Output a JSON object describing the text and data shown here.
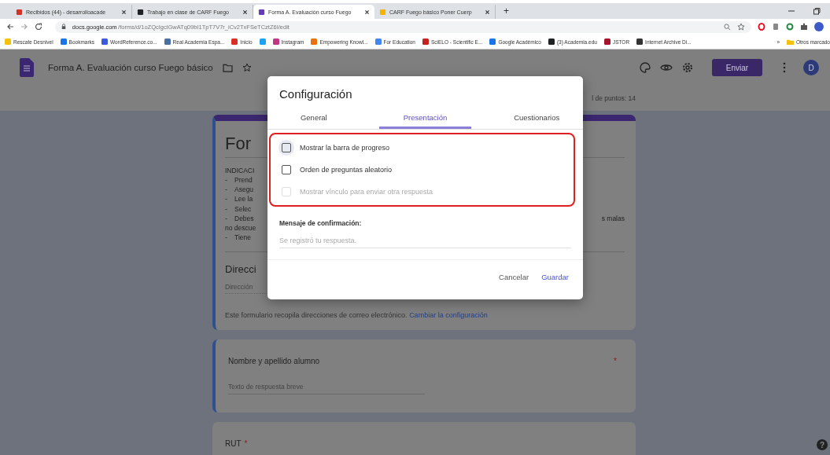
{
  "browser": {
    "tabs": [
      {
        "title": "Recibidos (44) - desarrolloacade",
        "selected": false,
        "color": "#d93025"
      },
      {
        "title": "Trabajo en clase de CARF Fuego",
        "selected": false,
        "color": "#202124"
      },
      {
        "title": "Forma A. Evaluación curso Fuego",
        "selected": true,
        "color": "#673ab7"
      },
      {
        "title": "CARF Fuego básico Poner Cuerp",
        "selected": false,
        "color": "#f4b400"
      }
    ],
    "new_tab": "+",
    "address": {
      "domain": "docs.google.com",
      "path": "/forms/d/1oZQcIgclGwATq09bI1TpT7V7r_iCv2TxFSeTCztZ6I/edit"
    },
    "bookmarks": [
      {
        "label": "Rescate Desnivel",
        "color": "#f4c20d"
      },
      {
        "label": "Bookmarks",
        "color": "#1a73e8"
      },
      {
        "label": "WordReference.co...",
        "color": "#3b5bdb"
      },
      {
        "label": "Real Academia Espa...",
        "color": "#4a6fa5"
      },
      {
        "label": "Inicio",
        "color": "#d93025"
      },
      {
        "color": "#1da1f2"
      },
      {
        "label": "Instagram",
        "color": "#c13584"
      },
      {
        "label": "Empowering Knowl...",
        "color": "#e8710a"
      },
      {
        "label": "For Education",
        "color": "#4285f4"
      },
      {
        "label": "SciELO - Scientific E...",
        "color": "#c5221f"
      },
      {
        "label": "Google Académico",
        "color": "#1a73e8"
      },
      {
        "label": "(3) Academia.edu",
        "color": "#202124"
      },
      {
        "label": "JSTOR",
        "color": "#a5142b"
      },
      {
        "label": "Internet Archive Di...",
        "color": "#333333"
      }
    ],
    "bookmarks_more": "»",
    "other_bookmarks": "Otros marcado"
  },
  "form_header": {
    "title": "Forma A. Evaluación curso Fuego básico",
    "send_button": "Enviar",
    "avatar": "D"
  },
  "points_text": "l de puntos: 14",
  "form_card": {
    "title": "For",
    "heading": "INDICACI",
    "lines": [
      {
        "bullet": "-",
        "text": "Prend"
      },
      {
        "bullet": "-",
        "text": "Asegu"
      },
      {
        "bullet": "-",
        "text": "Lee la"
      },
      {
        "bullet": "-",
        "text": "Selec"
      },
      {
        "bullet": "-",
        "text": "Debes",
        "tail": "s malas"
      },
      {
        "text": "no descue"
      },
      {
        "bullet": "-",
        "text": "Tiene"
      }
    ],
    "email_title": "Direcci",
    "email_placeholder": "Dirección",
    "note": {
      "text": "Este formulario recopila direcciones de correo electrónico.",
      "link": "Cambiar la configuración"
    }
  },
  "questions": [
    {
      "title": "Nombre y apellido alumno",
      "required_mark": "*",
      "placeholder": "Texto de respuesta breve",
      "selected": true
    },
    {
      "title": "RUT",
      "required_mark": "*",
      "selected": false
    }
  ],
  "help": "?",
  "dialog": {
    "title": "Configuración",
    "tabs": [
      {
        "label": "General",
        "selected": false
      },
      {
        "label": "Presentación",
        "selected": true
      },
      {
        "label": "Cuestionarios",
        "selected": false
      }
    ],
    "options": [
      {
        "label": "Mostrar la barra de progreso",
        "checked": false,
        "disabled": false,
        "focused": true
      },
      {
        "label": "Orden de preguntas aleatorio",
        "checked": false,
        "disabled": false,
        "focused": false
      },
      {
        "label": "Mostrar vínculo para enviar otra respuesta",
        "checked": false,
        "disabled": true,
        "focused": false
      }
    ],
    "confirmation": {
      "label": "Mensaje de confirmación:",
      "placeholder": "Se registró tu respuesta."
    },
    "buttons": [
      {
        "label": "Cancelar",
        "kind": "secondary"
      },
      {
        "label": "Guardar",
        "kind": "primary"
      }
    ]
  }
}
